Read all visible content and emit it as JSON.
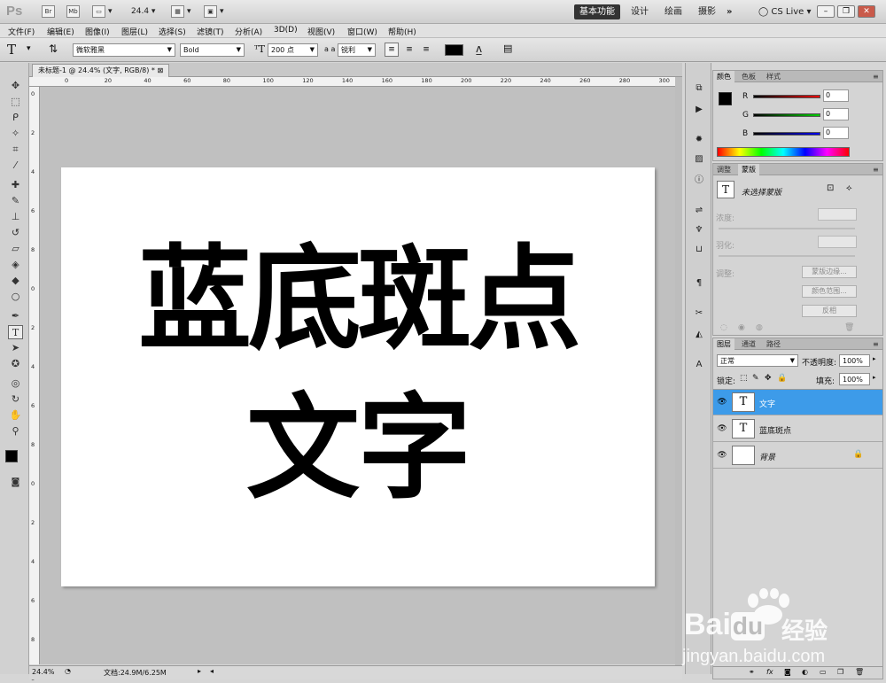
{
  "app": {
    "logo": "Ps",
    "zoom": "24.4",
    "icons": [
      "Br",
      "Mb"
    ],
    "workspaces": [
      "基本功能",
      "设计",
      "绘画",
      "摄影"
    ],
    "more": "»",
    "cslive": "CS Live"
  },
  "menu": [
    "文件(F)",
    "编辑(E)",
    "图像(I)",
    "图层(L)",
    "选择(S)",
    "滤镜(T)",
    "分析(A)",
    "3D(D)",
    "视图(V)",
    "窗口(W)",
    "帮助(H)"
  ],
  "options": {
    "font_family": "微软雅黑",
    "font_style": "Bold",
    "font_size": "200 点",
    "aa_label": "a a",
    "antialias": "锐利",
    "text_color": "#000000"
  },
  "document": {
    "tab_title": "未标题-1 @ 24.4% (文字, RGB/8) *",
    "canvas_lines": [
      "蓝底斑点",
      "文字"
    ]
  },
  "ruler_h": [
    "0",
    "20",
    "40",
    "60",
    "80",
    "100",
    "120",
    "140",
    "160",
    "180",
    "200",
    "220",
    "240",
    "260",
    "280",
    "300"
  ],
  "ruler_v": [
    "0",
    "2",
    "4",
    "6",
    "8",
    "0",
    "2",
    "4",
    "6",
    "8",
    "0",
    "2",
    "4",
    "6",
    "8",
    "0"
  ],
  "status": {
    "zoom": "24.4%",
    "doc": "文档:24.9M/6.25M"
  },
  "color_panel": {
    "tabs": [
      "颜色",
      "色板",
      "样式"
    ],
    "channels": [
      {
        "label": "R",
        "value": "0"
      },
      {
        "label": "G",
        "value": "0"
      },
      {
        "label": "B",
        "value": "0"
      }
    ]
  },
  "adjust_panel": {
    "tabs": [
      "调整",
      "蒙版"
    ],
    "mask_label": "未选择蒙版",
    "density": "浓度:",
    "feather": "羽化:",
    "refine": "调整:",
    "buttons": [
      "蒙版边缘...",
      "颜色范围...",
      "反相"
    ]
  },
  "layers_panel": {
    "tabs": [
      "图层",
      "通道",
      "路径"
    ],
    "blend_mode": "正常",
    "opacity_label": "不透明度:",
    "opacity": "100%",
    "lock_label": "锁定:",
    "fill_label": "填充:",
    "fill": "100%",
    "layers": [
      {
        "name": "文字",
        "thumb": "T",
        "selected": true
      },
      {
        "name": "蓝底斑点",
        "thumb": "T",
        "selected": false
      },
      {
        "name": "背景",
        "thumb": "",
        "selected": false
      }
    ]
  },
  "watermark": {
    "brand": "Bai",
    "brand2": "du",
    "cn": "经验",
    "url": "jingyan.baidu.com"
  }
}
